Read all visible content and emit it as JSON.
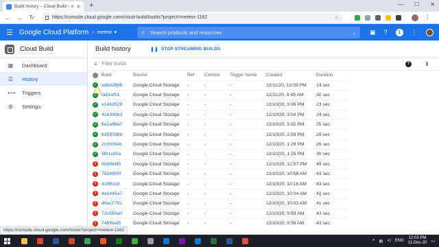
{
  "browser": {
    "tab_title": "Build history – Cloud Build – me",
    "new_tab_symbol": "+",
    "url": "https://console.cloud.google.com/cloud-build/builds?project=meteor-1162",
    "status_link": "https://console.cloud.google.com/home?project=meteor-1162"
  },
  "header": {
    "brand": "Google Cloud Platform",
    "project": "meteor",
    "search_placeholder": "Search products and resources",
    "notification_count": "1",
    "accent_color": "#1a73e8"
  },
  "sidebar": {
    "product": "Cloud Build",
    "items": [
      {
        "label": "Dashboard",
        "icon": "dashboard-icon",
        "glyph": "▦",
        "active": false
      },
      {
        "label": "History",
        "icon": "list-icon",
        "glyph": "☰",
        "active": true
      },
      {
        "label": "Triggers",
        "icon": "arrows-icon",
        "glyph": "⟷",
        "active": false
      },
      {
        "label": "Settings",
        "icon": "gear-icon",
        "glyph": "⚙",
        "active": false
      }
    ],
    "collapse_glyph": "◁|"
  },
  "main": {
    "title": "Build history",
    "stop_button": "STOP STREAMING BUILDS",
    "filter_placeholder": "Filter builds",
    "columns": [
      "Build",
      "Source",
      "Ref",
      "Commit",
      "Trigger Name",
      "Created",
      "Duration"
    ],
    "builds": [
      {
        "status": "success",
        "id": "adb428d5",
        "source": "Google Cloud Storage",
        "ref": "-",
        "commit": "-",
        "trigger": "-",
        "created": "12/11/20, 12:03 PM",
        "duration": "14 sec"
      },
      {
        "status": "success",
        "id": "fa54af01",
        "source": "Google Cloud Storage",
        "ref": "-",
        "commit": "-",
        "trigger": "-",
        "created": "12/11/20, 9:49 AM",
        "duration": "30 sec"
      },
      {
        "status": "success",
        "id": "e14bd529",
        "source": "Google Cloud Storage",
        "ref": "-",
        "commit": "-",
        "trigger": "-",
        "created": "12/10/20, 3:06 PM",
        "duration": "23 sec"
      },
      {
        "status": "success",
        "id": "41b3b0b3",
        "source": "Google Cloud Storage",
        "ref": "-",
        "commit": "-",
        "trigger": "-",
        "created": "12/10/20, 3:04 PM",
        "duration": "24 sec"
      },
      {
        "status": "success",
        "id": "6e1a86a7",
        "source": "Google Cloud Storage",
        "ref": "-",
        "commit": "-",
        "trigger": "-",
        "created": "12/10/20, 3:02 PM",
        "duration": "25 sec"
      },
      {
        "status": "success",
        "id": "6259788b",
        "source": "Google Cloud Storage",
        "ref": "-",
        "commit": "-",
        "trigger": "-",
        "created": "12/10/20, 2:59 PM",
        "duration": "29 sec"
      },
      {
        "status": "success",
        "id": "2c99064b",
        "source": "Google Cloud Storage",
        "ref": "-",
        "commit": "-",
        "trigger": "-",
        "created": "12/10/20, 1:29 PM",
        "duration": "26 sec"
      },
      {
        "status": "success",
        "id": "5f01e80a",
        "source": "Google Cloud Storage",
        "ref": "-",
        "commit": "-",
        "trigger": "-",
        "created": "12/10/20, 1:25 PM",
        "duration": "30 sec"
      },
      {
        "status": "failure",
        "id": "f8d86d40",
        "source": "Google Cloud Storage",
        "ref": "-",
        "commit": "-",
        "trigger": "-",
        "created": "12/10/20, 12:57 PM",
        "duration": "49 sec"
      },
      {
        "status": "failure",
        "id": "7934900f",
        "source": "Google Cloud Storage",
        "ref": "-",
        "commit": "-",
        "trigger": "-",
        "created": "12/10/20, 10:58 AM",
        "duration": "43 sec"
      },
      {
        "status": "failure",
        "id": "41f8f1cb",
        "source": "Google Cloud Storage",
        "ref": "-",
        "commit": "-",
        "trigger": "-",
        "created": "12/10/20, 10:16 AM",
        "duration": "43 sec"
      },
      {
        "status": "failure",
        "id": "4a1445a7",
        "source": "Google Cloud Storage",
        "ref": "-",
        "commit": "-",
        "trigger": "-",
        "created": "12/10/20, 10:04 AM",
        "duration": "42 sec"
      },
      {
        "status": "failure",
        "id": "40ac7791",
        "source": "Google Cloud Storage",
        "ref": "-",
        "commit": "-",
        "trigger": "-",
        "created": "12/10/20, 10:03 AM",
        "duration": "41 sec"
      },
      {
        "status": "failure",
        "id": "72c554a0",
        "source": "Google Cloud Storage",
        "ref": "-",
        "commit": "-",
        "trigger": "-",
        "created": "12/10/20, 9:59 AM",
        "duration": "43 sec"
      },
      {
        "status": "failure",
        "id": "745fbad5",
        "source": "Google Cloud Storage",
        "ref": "-",
        "commit": "-",
        "trigger": "-",
        "created": "12/10/20, 9:58 AM",
        "duration": "43 sec"
      }
    ],
    "status_colors": {
      "success": "#1e8e3e",
      "failure": "#d93025"
    }
  },
  "taskbar": {
    "apps": [
      {
        "name": "file-explorer-icon",
        "color": "#f4c542"
      },
      {
        "name": "chrome-icon",
        "color": "#ea4335"
      },
      {
        "name": "terminal-icon",
        "color": "#2b5797"
      },
      {
        "name": "powerpoint-icon",
        "color": "#d24726"
      },
      {
        "name": "chrome-alt-icon",
        "color": "#34a853"
      },
      {
        "name": "brave-icon",
        "color": "#fb542b"
      },
      {
        "name": "photos-icon",
        "color": "#107c10"
      },
      {
        "name": "camtasia-icon",
        "color": "#3cb043"
      },
      {
        "name": "notepad-icon",
        "color": "#9e9e9e"
      },
      {
        "name": "edge-icon",
        "color": "#0078d7"
      },
      {
        "name": "onenote-icon",
        "color": "#7719aa"
      },
      {
        "name": "vscode-icon",
        "color": "#007acc"
      },
      {
        "name": "excel-icon",
        "color": "#217346"
      },
      {
        "name": "word-icon",
        "color": "#2b579a"
      },
      {
        "name": "office-icon",
        "color": "#e74c3c"
      }
    ],
    "language": "ENG",
    "time": "12:03 PM",
    "date": "11-Dec-20"
  }
}
